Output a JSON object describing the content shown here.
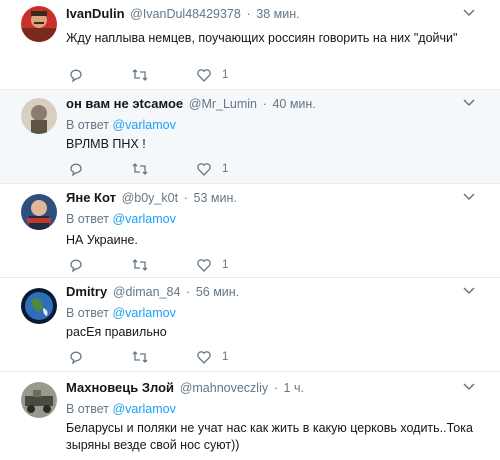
{
  "reply_prefix": "В ответ",
  "tweets": [
    {
      "name": "IvanDulin",
      "handle": "@IvanDul48429378",
      "time": "38 мин.",
      "reply_to": null,
      "text": "Жду наплыва немцев, поучающих россиян говорить на них \"дойчи\"",
      "likes": "1"
    },
    {
      "name": "он вам не эtсамое",
      "handle": "@Mr_Lumin",
      "time": "40 мин.",
      "reply_to": "@varlamov",
      "text": "ВРЛМВ ПНХ !",
      "likes": "1"
    },
    {
      "name": "Яне Кот",
      "handle": "@b0y_k0t",
      "time": "53 мин.",
      "reply_to": "@varlamov",
      "text": "НА Украине.",
      "likes": "1"
    },
    {
      "name": "Dmitry",
      "handle": "@diman_84",
      "time": "56 мин.",
      "reply_to": "@varlamov",
      "text": "расЕя правильно",
      "likes": "1"
    },
    {
      "name": "Махновець Злой",
      "handle": "@mahnoveczliy",
      "time": "1 ч.",
      "reply_to": "@varlamov",
      "text": "Беларусы и поляки не учат нас как жить в какую церковь ходить..Тока зыряны везде свой нос суют))",
      "likes": null
    }
  ]
}
